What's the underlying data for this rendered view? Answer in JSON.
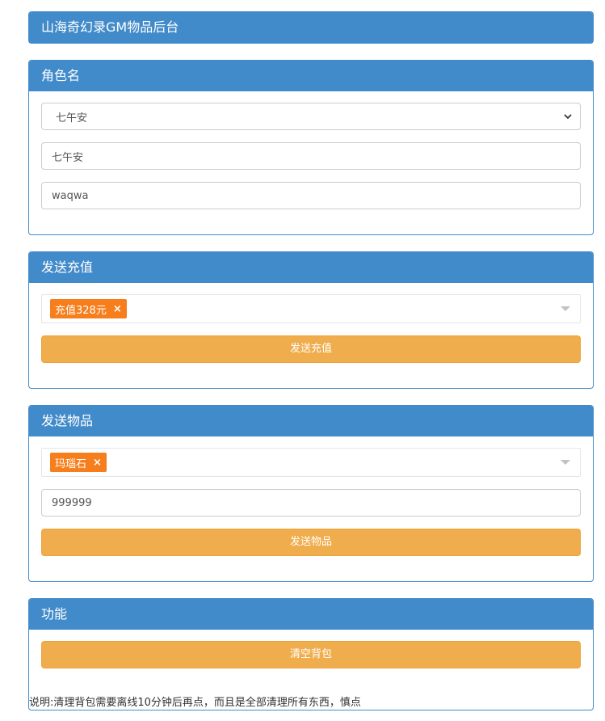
{
  "header": {
    "title": "山海奇幻录GM物品后台"
  },
  "role_panel": {
    "title": "角色名",
    "server_select": {
      "value": "七午安"
    },
    "role_name_input": {
      "value": "七午安"
    },
    "account_input": {
      "value": "waqwa"
    }
  },
  "recharge_panel": {
    "title": "发送充值",
    "selected_tag": "充值328元",
    "remove_glyph": "×",
    "button_label": "发送充值"
  },
  "item_panel": {
    "title": "发送物品",
    "selected_tag": "玛瑙石",
    "remove_glyph": "×",
    "quantity_input": {
      "value": "999999"
    },
    "button_label": "发送物品"
  },
  "function_panel": {
    "title": "功能",
    "clear_button_label": "清空背包",
    "note": "说明:清理背包需要离线10分钟后再点，而且是全部清理所有东西，慎点"
  },
  "colors": {
    "panel_primary": "#428bca",
    "button_warning": "#f0ad4e",
    "tag_orange": "#f77e1c"
  }
}
